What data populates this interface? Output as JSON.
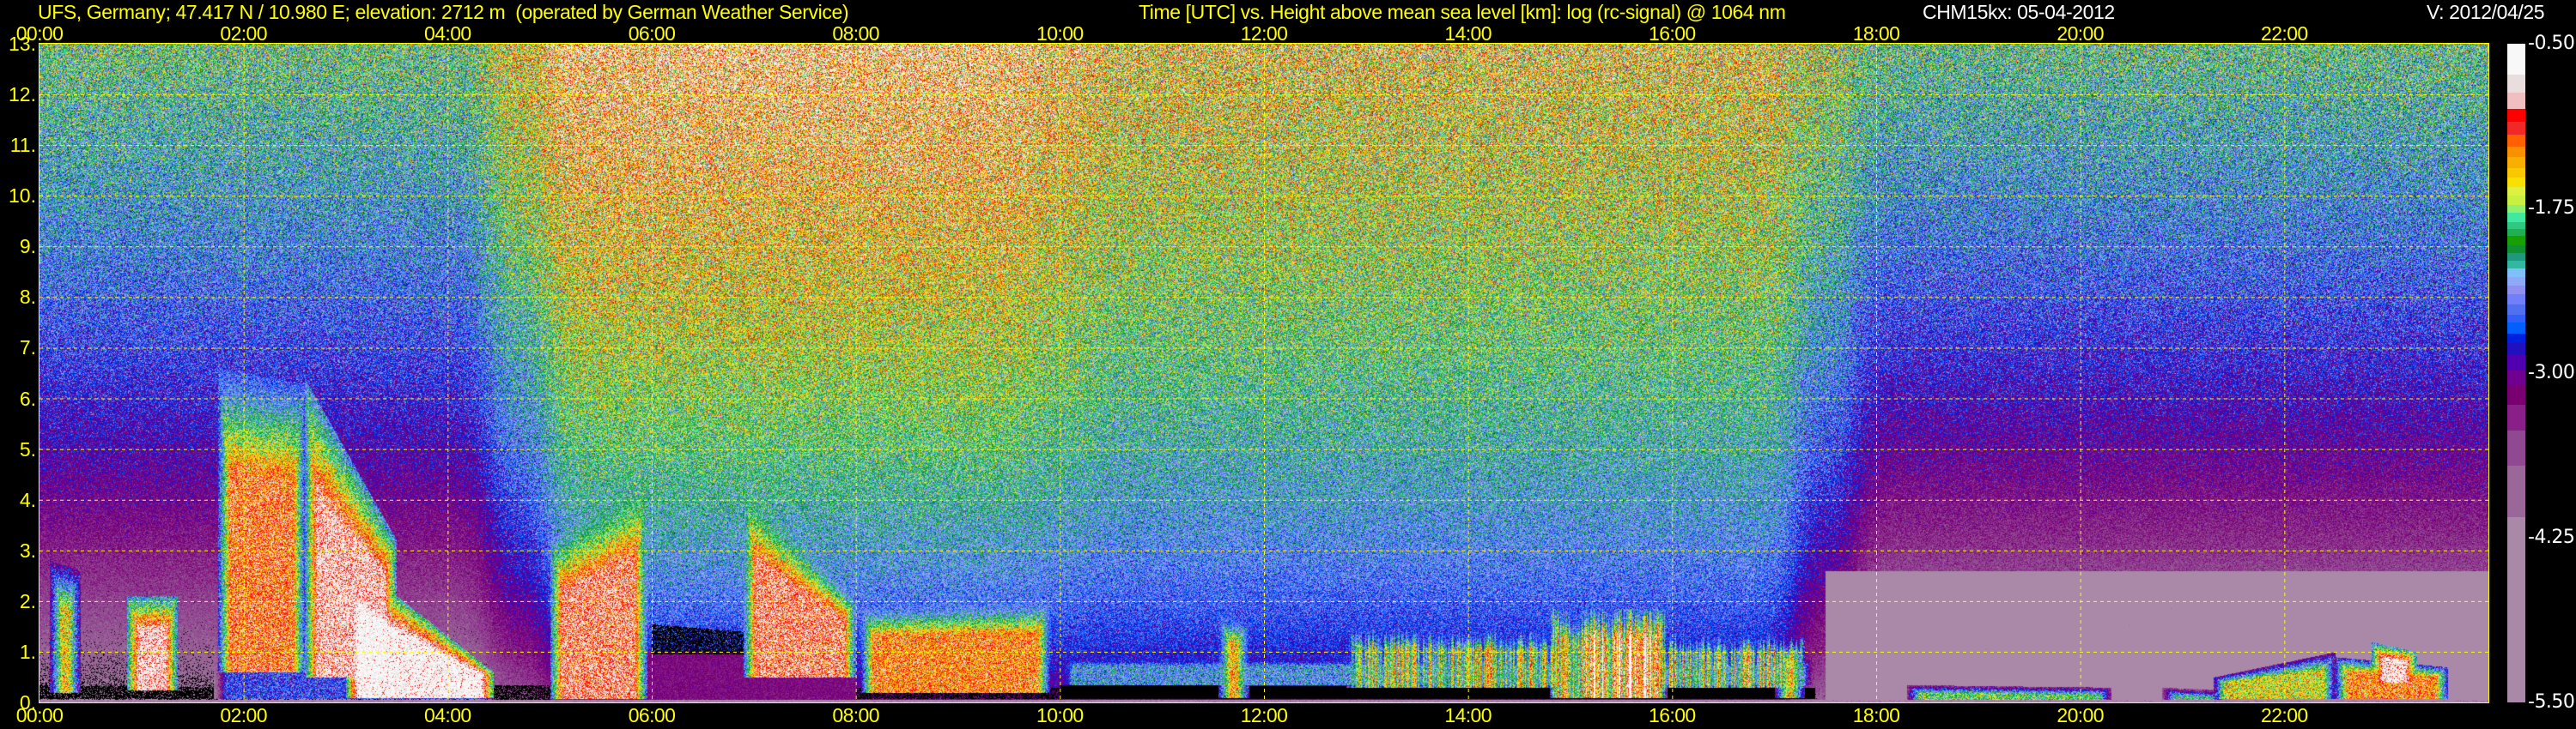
{
  "header": {
    "title": "UFS, Germany; 47.417 N / 10.980 E; elevation: 2712 m  (operated by German Weather Service)",
    "subtitle": "Time [UTC] vs. Height above mean sea level [km]: log (rc-signal) @ 1064 nm",
    "instrument": "CHM15kx: 05-04-2012",
    "version": "V: 2012/04/25"
  },
  "chart_data": {
    "type": "heatmap",
    "title": "Time [UTC] vs. Height above mean sea level [km]: log (rc-signal) @ 1064 nm",
    "xlabel": "Time [UTC]",
    "ylabel": "Height above mean sea level [km]",
    "xlim": [
      0,
      24
    ],
    "ylim": [
      0,
      13
    ],
    "grid": true,
    "x_ticks": [
      {
        "value": 0,
        "label": "00:00"
      },
      {
        "value": 2,
        "label": "02:00"
      },
      {
        "value": 4,
        "label": "04:00"
      },
      {
        "value": 6,
        "label": "06:00"
      },
      {
        "value": 8,
        "label": "08:00"
      },
      {
        "value": 10,
        "label": "10:00"
      },
      {
        "value": 12,
        "label": "12:00"
      },
      {
        "value": 14,
        "label": "14:00"
      },
      {
        "value": 16,
        "label": "16:00"
      },
      {
        "value": 18,
        "label": "18:00"
      },
      {
        "value": 20,
        "label": "20:00"
      },
      {
        "value": 22,
        "label": "22:00"
      }
    ],
    "y_ticks": [
      {
        "value": 0,
        "label": "0."
      },
      {
        "value": 1,
        "label": "1."
      },
      {
        "value": 2,
        "label": "2."
      },
      {
        "value": 3,
        "label": "3."
      },
      {
        "value": 4,
        "label": "4."
      },
      {
        "value": 5,
        "label": "5."
      },
      {
        "value": 6,
        "label": "6."
      },
      {
        "value": 7,
        "label": "7."
      },
      {
        "value": 8,
        "label": "8."
      },
      {
        "value": 9,
        "label": "9."
      },
      {
        "value": 10,
        "label": "10."
      },
      {
        "value": 11,
        "label": "11."
      },
      {
        "value": 12,
        "label": "12."
      },
      {
        "value": 13,
        "label": "13."
      }
    ],
    "colorbar": {
      "range": [
        -5.5,
        -0.5
      ],
      "ticks": [
        {
          "value": -0.5,
          "label": "-0.50"
        },
        {
          "value": -1.75,
          "label": "-1.75"
        },
        {
          "value": -3.0,
          "label": "-3.00"
        },
        {
          "value": -4.25,
          "label": "-4.25"
        },
        {
          "value": -5.5,
          "label": "-5.50"
        }
      ],
      "below_range_color": "#000000",
      "bands": [
        {
          "from": -0.732,
          "color": "#f8f8f8"
        },
        {
          "from": -0.869,
          "color": "#e8dede"
        },
        {
          "from": -0.995,
          "color": "#f0c0c0"
        },
        {
          "from": -1.09,
          "color": "#ff0000"
        },
        {
          "from": -1.193,
          "color": "#f02828"
        },
        {
          "from": -1.278,
          "color": "#ff6000"
        },
        {
          "from": -1.36,
          "color": "#f89000"
        },
        {
          "from": -1.442,
          "color": "#f8b000"
        },
        {
          "from": -1.517,
          "color": "#f8c800"
        },
        {
          "from": -1.585,
          "color": "#f8e000"
        },
        {
          "from": -1.654,
          "color": "#e0f040"
        },
        {
          "from": -1.722,
          "color": "#c8f040"
        },
        {
          "from": -1.78,
          "color": "#90f070"
        },
        {
          "from": -1.855,
          "color": "#40e8a0"
        },
        {
          "from": -1.906,
          "color": "#30c880"
        },
        {
          "from": -1.961,
          "color": "#20b050"
        },
        {
          "from": -2.029,
          "color": "#18a000"
        },
        {
          "from": -2.087,
          "color": "#109030"
        },
        {
          "from": -2.145,
          "color": "#209880"
        },
        {
          "from": -2.207,
          "color": "#30b8a0"
        },
        {
          "from": -2.268,
          "color": "#80c0f8"
        },
        {
          "from": -2.336,
          "color": "#90a8f8"
        },
        {
          "from": -2.404,
          "color": "#9090f0"
        },
        {
          "from": -2.48,
          "color": "#7080f8"
        },
        {
          "from": -2.555,
          "color": "#5070f0"
        },
        {
          "from": -2.616,
          "color": "#3060f8"
        },
        {
          "from": -2.701,
          "color": "#0060ff"
        },
        {
          "from": -2.773,
          "color": "#0020e0"
        },
        {
          "from": -2.865,
          "color": "#2010c0"
        },
        {
          "from": -2.981,
          "color": "#5000b0"
        },
        {
          "from": -3.094,
          "color": "#700090"
        },
        {
          "from": -3.241,
          "color": "#780070"
        },
        {
          "from": -3.435,
          "color": "#882088"
        },
        {
          "from": -3.701,
          "color": "#904890"
        },
        {
          "from": -4.094,
          "color": "#9a6898"
        },
        {
          "from": -5.5,
          "color": "#aa88a8"
        }
      ]
    },
    "background": [
      {
        "t0": 0.0,
        "t1": 4.7,
        "top_value": -1.95,
        "bottom_value": -4.4,
        "noise": 0.55
      },
      {
        "t0": 4.7,
        "t1": 10.0,
        "top_value": -1.05,
        "bottom_value": -3.3,
        "noise": 0.75
      },
      {
        "t0": 10.0,
        "t1": 17.5,
        "top_value": -1.45,
        "bottom_value": -3.2,
        "noise": 0.7
      },
      {
        "t0": 17.5,
        "t1": 24.0,
        "top_value": -2.0,
        "bottom_value": -4.6,
        "noise": 0.55
      }
    ],
    "features": [
      {
        "t0": 0.0,
        "t1": 24.0,
        "h0": 0.0,
        "h1": 0.06,
        "h1_end": 0.06,
        "value": -4.2,
        "mode": "set"
      },
      {
        "t0": 0.0,
        "t1": 1.7,
        "h0": 0.08,
        "h1": 0.35,
        "h1_end": 0.3,
        "value": -9,
        "mode": "speckle"
      },
      {
        "t0": 0.1,
        "t1": 0.4,
        "h0": 0.2,
        "h1": 2.8,
        "h1_end": 2.6,
        "value": -1.5,
        "mode": "max"
      },
      {
        "t0": 0.85,
        "t1": 1.35,
        "h0": 0.25,
        "h1": 2.1,
        "h1_end": 2.1,
        "value": -0.8,
        "mode": "max"
      },
      {
        "t0": 1.7,
        "t1": 4.5,
        "h0": 0.08,
        "h1": 1.9,
        "h1_end": 0.5,
        "value": -2.65,
        "mode": "max"
      },
      {
        "t0": 1.75,
        "t1": 2.6,
        "h0": 0.6,
        "h1": 6.6,
        "h1_end": 6.3,
        "value": -1.15,
        "mode": "max"
      },
      {
        "t0": 2.6,
        "t1": 3.5,
        "h0": 0.5,
        "h1": 6.4,
        "h1_end": 3.2,
        "value": -0.85,
        "mode": "max"
      },
      {
        "t0": 3.0,
        "t1": 4.45,
        "h0": 0.1,
        "h1": 2.9,
        "h1_end": 0.6,
        "value": -0.6,
        "mode": "max"
      },
      {
        "t0": 4.45,
        "t1": 5.0,
        "h0": 0.06,
        "h1": 0.35,
        "h1_end": 0.35,
        "value": -9,
        "mode": "speckle"
      },
      {
        "t0": 5.0,
        "t1": 5.95,
        "h0": 0.08,
        "h1": 3.2,
        "h1_end": 4.5,
        "value": -1.0,
        "mode": "max"
      },
      {
        "t0": 5.95,
        "t1": 8.0,
        "h0": 0.08,
        "h1": 1.0,
        "h1_end": 1.0,
        "value": -3.2,
        "mode": "set"
      },
      {
        "t0": 6.0,
        "t1": 6.9,
        "h0": 0.95,
        "h1": 1.55,
        "h1_end": 1.4,
        "value": -9,
        "mode": "speckle"
      },
      {
        "t0": 6.9,
        "t1": 8.0,
        "h0": 0.5,
        "h1": 4.3,
        "h1_end": 2.0,
        "value": -1.0,
        "mode": "max"
      },
      {
        "t0": 8.0,
        "t1": 10.0,
        "h0": 0.08,
        "h1": 0.3,
        "h1_end": 0.3,
        "value": -9,
        "mode": "speckle"
      },
      {
        "t0": 8.05,
        "t1": 9.9,
        "h0": 0.2,
        "h1": 1.9,
        "h1_end": 2.0,
        "value": -1.25,
        "mode": "max"
      },
      {
        "t0": 10.0,
        "t1": 17.4,
        "h0": 0.08,
        "h1": 0.35,
        "h1_end": 0.3,
        "value": -9,
        "mode": "set"
      },
      {
        "t0": 10.0,
        "t1": 17.4,
        "h0": 0.35,
        "h1": 0.95,
        "h1_end": 0.9,
        "value": -2.35,
        "mode": "max"
      },
      {
        "t0": 11.55,
        "t1": 11.85,
        "h0": 0.1,
        "h1": 1.8,
        "h1_end": 1.6,
        "value": -1.4,
        "mode": "max"
      },
      {
        "t0": 12.8,
        "t1": 17.3,
        "h0": 0.3,
        "h1": 1.5,
        "h1_end": 1.3,
        "value": -1.95,
        "mode": "streak"
      },
      {
        "t0": 14.8,
        "t1": 15.95,
        "h0": 0.1,
        "h1": 1.85,
        "h1_end": 1.85,
        "value": -1.3,
        "mode": "streak"
      },
      {
        "t0": 17.0,
        "t1": 17.3,
        "h0": 0.1,
        "h1": 1.2,
        "h1_end": 1.1,
        "value": -1.6,
        "mode": "max"
      },
      {
        "t0": 17.5,
        "t1": 24.0,
        "h0": 0.06,
        "h1": 2.6,
        "h1_end": 2.6,
        "value": -4.4,
        "mode": "set"
      },
      {
        "t0": 18.3,
        "t1": 20.3,
        "h0": 0.06,
        "h1": 0.35,
        "h1_end": 0.3,
        "value": -1.9,
        "mode": "max"
      },
      {
        "t0": 20.8,
        "t1": 21.4,
        "h0": 0.06,
        "h1": 0.3,
        "h1_end": 0.25,
        "value": -2.1,
        "mode": "max"
      },
      {
        "t0": 21.3,
        "t1": 22.5,
        "h0": 0.08,
        "h1": 0.5,
        "h1_end": 1.0,
        "value": -1.6,
        "mode": "max"
      },
      {
        "t0": 22.5,
        "t1": 23.6,
        "h0": 0.08,
        "h1": 0.9,
        "h1_end": 0.7,
        "value": -1.25,
        "mode": "max"
      },
      {
        "t0": 22.85,
        "t1": 23.3,
        "h0": 0.4,
        "h1": 1.2,
        "h1_end": 1.0,
        "value": -0.75,
        "mode": "max"
      }
    ]
  }
}
